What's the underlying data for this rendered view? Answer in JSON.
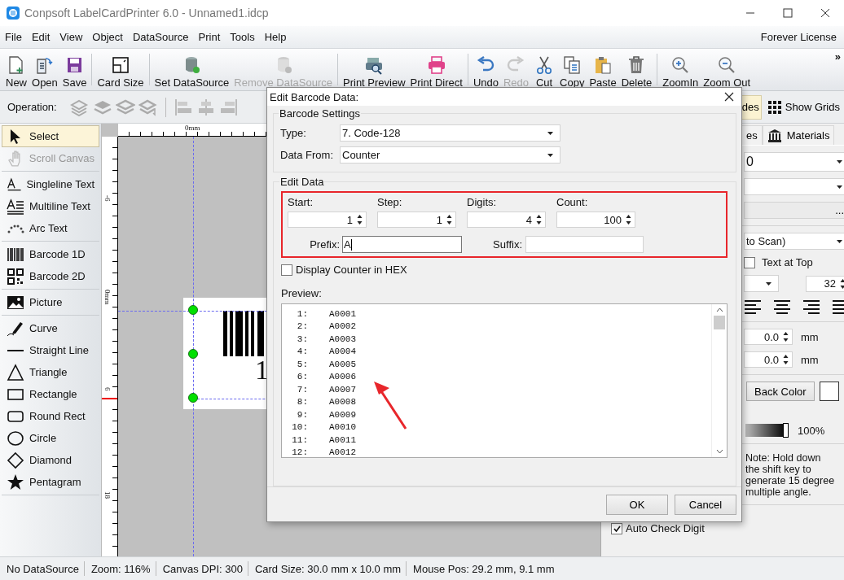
{
  "window": {
    "title": "Conpsoft LabelCardPrinter 6.0 - Unnamed1.idcp"
  },
  "menu": [
    "File",
    "Edit",
    "View",
    "Object",
    "DataSource",
    "Print",
    "Tools",
    "Help"
  ],
  "license": "Forever License",
  "toolbar_groups": [
    {
      "items": [
        {
          "label": "New",
          "disabled": false
        },
        {
          "label": "Open",
          "disabled": false
        },
        {
          "label": "Save",
          "disabled": false
        }
      ]
    },
    {
      "items": [
        {
          "label": "Card Size",
          "disabled": false
        }
      ]
    },
    {
      "items": [
        {
          "label": "Set DataSource",
          "disabled": false
        },
        {
          "label": "Remove DataSource",
          "disabled": true
        }
      ]
    },
    {
      "items": [
        {
          "label": "Print Preview",
          "disabled": false
        },
        {
          "label": "Print Direct",
          "disabled": false
        }
      ]
    },
    {
      "items": [
        {
          "label": "Undo",
          "disabled": false
        },
        {
          "label": "Redo",
          "disabled": true
        },
        {
          "label": "Cut",
          "disabled": false
        },
        {
          "label": "Copy",
          "disabled": false
        },
        {
          "label": "Paste",
          "disabled": false
        },
        {
          "label": "Delete",
          "disabled": false
        }
      ]
    },
    {
      "items": [
        {
          "label": "ZoomIn",
          "disabled": false
        },
        {
          "label": "Zoom Out",
          "disabled": false
        }
      ]
    }
  ],
  "toolbar_more": "»",
  "operation_bar": {
    "label": "Operation:",
    "toggles": [
      {
        "label": "des",
        "selected": true
      },
      {
        "label": "Show Grids",
        "selected": false
      }
    ]
  },
  "tool_groups": [
    {
      "items": [
        {
          "label": "Select",
          "selected": true,
          "disabled": false
        },
        {
          "label": "Scroll Canvas",
          "selected": false,
          "disabled": true
        }
      ]
    },
    {
      "items": [
        {
          "label": "Singleline Text",
          "selected": false,
          "disabled": false
        },
        {
          "label": "Multiline Text",
          "selected": false,
          "disabled": false
        },
        {
          "label": "Arc Text",
          "selected": false,
          "disabled": false
        }
      ]
    },
    {
      "items": [
        {
          "label": "Barcode 1D",
          "selected": false,
          "disabled": false
        },
        {
          "label": "Barcode 2D",
          "selected": false,
          "disabled": false
        }
      ]
    },
    {
      "items": [
        {
          "label": "Picture",
          "selected": false,
          "disabled": false
        }
      ]
    },
    {
      "items": [
        {
          "label": "Curve",
          "selected": false,
          "disabled": false
        },
        {
          "label": "Straight Line",
          "selected": false,
          "disabled": false
        },
        {
          "label": "Triangle",
          "selected": false,
          "disabled": false
        },
        {
          "label": "Rectangle",
          "selected": false,
          "disabled": false
        },
        {
          "label": "Round Rect",
          "selected": false,
          "disabled": false
        },
        {
          "label": "Circle",
          "selected": false,
          "disabled": false
        },
        {
          "label": "Diamond",
          "selected": false,
          "disabled": false
        },
        {
          "label": "Pentagram",
          "selected": false,
          "disabled": false
        }
      ]
    }
  ],
  "canvas": {
    "top_ruler_labels": [
      "0mm"
    ],
    "left_ruler_labels": [
      "-6",
      "0mm",
      "6",
      "18"
    ],
    "label_text": "1"
  },
  "properties": {
    "tabs": [
      {
        "label": "es",
        "selected": false
      },
      {
        "label": "Materials",
        "selected": false
      }
    ],
    "combo_1": "0",
    "field_button": "...",
    "combo_3": "to Scan)",
    "text_at_top": {
      "label": "Text at Top",
      "checked": false
    },
    "font_size": "32",
    "offsets": [
      {
        "value": "0.0",
        "unit": "mm"
      },
      {
        "value": "0.0",
        "unit": "mm"
      }
    ],
    "back_color_button": "Back Color",
    "opacity": {
      "level": 1,
      "reading": "100%"
    },
    "note": [
      "Note: Hold down",
      "the shift key to",
      "generate 15 degree",
      "multiple angle."
    ],
    "auto_check_digit": {
      "label": "Auto Check Digit",
      "checked": true
    }
  },
  "dialog": {
    "title": "Edit Barcode Data:",
    "settings_group": "Barcode Settings",
    "type": {
      "label": "Type:",
      "value": "7.  Code-128"
    },
    "data_from": {
      "label": "Data From:",
      "value": "Counter"
    },
    "edit_group": "Edit Data",
    "spinners": [
      {
        "label": "Start:",
        "value": "1"
      },
      {
        "label": "Step:",
        "value": "1"
      },
      {
        "label": "Digits:",
        "value": "4"
      },
      {
        "label": "Count:",
        "value": "100"
      }
    ],
    "prefix": {
      "label": "Prefix:",
      "value": "A"
    },
    "suffix": {
      "label": "Suffix:"
    },
    "hex": {
      "label": "Display Counter in HEX",
      "checked": false
    },
    "preview_label": "Preview:",
    "preview": [
      {
        "number": "1:",
        "value": "A0001"
      },
      {
        "number": "2:",
        "value": "A0002"
      },
      {
        "number": "3:",
        "value": "A0003"
      },
      {
        "number": "4:",
        "value": "A0004"
      },
      {
        "number": "5:",
        "value": "A0005"
      },
      {
        "number": "6:",
        "value": "A0006"
      },
      {
        "number": "7:",
        "value": "A0007"
      },
      {
        "number": "8:",
        "value": "A0008"
      },
      {
        "number": "9:",
        "value": "A0009"
      },
      {
        "number": "10:",
        "value": "A0010"
      },
      {
        "number": "11:",
        "value": "A0011"
      },
      {
        "number": "12:",
        "value": "A0012"
      }
    ],
    "buttons": [
      "OK",
      "Cancel"
    ]
  },
  "status_bar": [
    "No DataSource",
    "Zoom: 116%",
    "Canvas DPI: 300",
    "Card Size: 30.0 mm x 10.0 mm",
    "Mouse Pos: 29.2 mm, 9.1 mm"
  ]
}
